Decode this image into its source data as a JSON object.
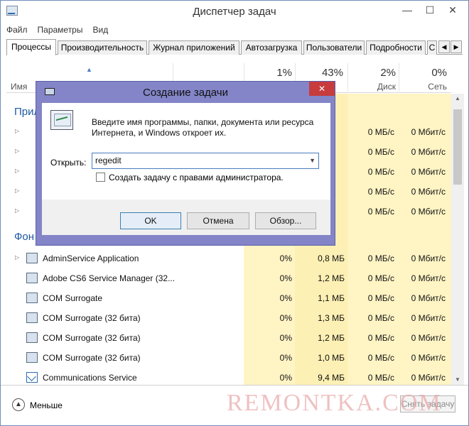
{
  "window": {
    "title": "Диспетчер задач"
  },
  "menu": [
    "Файл",
    "Параметры",
    "Вид"
  ],
  "tabs": [
    "Процессы",
    "Производительность",
    "Журнал приложений",
    "Автозагрузка",
    "Пользователи",
    "Подробности",
    "С"
  ],
  "columns": {
    "name": "Имя",
    "cpu_pct": "1%",
    "mem_pct": "43%",
    "disk_pct": "2%",
    "net_pct": "0%",
    "disk": "Диск",
    "net": "Сеть"
  },
  "sections": {
    "apps": "Прил",
    "background": "Фон"
  },
  "app_rows_partial": [
    {
      "disk": "0 МБ/с",
      "net": "0 Мбит/с"
    },
    {
      "disk": "0 МБ/с",
      "net": "0 Мбит/с"
    },
    {
      "disk": "0 МБ/с",
      "net": "0 Мбит/с"
    },
    {
      "disk": "0 МБ/с",
      "net": "0 Мбит/с"
    },
    {
      "disk": "0 МБ/с",
      "net": "0 Мбит/с"
    }
  ],
  "processes": [
    {
      "name": "AdminService Application",
      "cpu": "0%",
      "mem": "0,8 МБ",
      "disk": "0 МБ/с",
      "net": "0 Мбит/с"
    },
    {
      "name": "Adobe CS6 Service Manager (32...",
      "cpu": "0%",
      "mem": "1,2 МБ",
      "disk": "0 МБ/с",
      "net": "0 Мбит/с"
    },
    {
      "name": "COM Surrogate",
      "cpu": "0%",
      "mem": "1,1 МБ",
      "disk": "0 МБ/с",
      "net": "0 Мбит/с"
    },
    {
      "name": "COM Surrogate (32 бита)",
      "cpu": "0%",
      "mem": "1,3 МБ",
      "disk": "0 МБ/с",
      "net": "0 Мбит/с"
    },
    {
      "name": "COM Surrogate (32 бита)",
      "cpu": "0%",
      "mem": "1,2 МБ",
      "disk": "0 МБ/с",
      "net": "0 Мбит/с"
    },
    {
      "name": "COM Surrogate (32 бита)",
      "cpu": "0%",
      "mem": "1,0 МБ",
      "disk": "0 МБ/с",
      "net": "0 Мбит/с"
    },
    {
      "name": "Communications Service",
      "cpu": "0%",
      "mem": "9,4 МБ",
      "disk": "0 МБ/с",
      "net": "0 Мбит/с"
    }
  ],
  "footer": {
    "less": "Меньше",
    "end_task": "Снять задачу"
  },
  "watermark": "REMONTKA.COM",
  "dialog": {
    "title": "Создание задачи",
    "close": "✕",
    "description": "Введите имя программы, папки, документа или ресурса Интернета, и Windows откроет их.",
    "open_label": "Открыть:",
    "open_value": "regedit",
    "admin_label": "Создать задачу с правами администратора.",
    "ok": "OK",
    "cancel": "Отмена",
    "browse": "Обзор..."
  }
}
